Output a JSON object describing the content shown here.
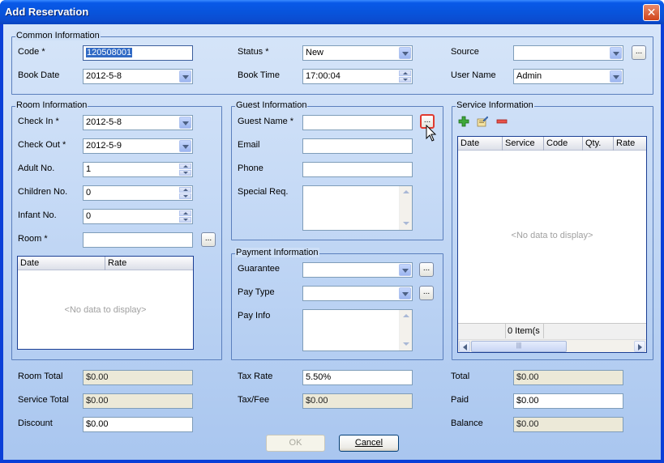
{
  "window": {
    "title": "Add Reservation",
    "close_glyph": "✕"
  },
  "common": {
    "title": "Common Information",
    "code_label": "Code *",
    "code_value": "120508001",
    "status_label": "Status *",
    "status_value": "New",
    "source_label": "Source",
    "source_value": "",
    "bookdate_label": "Book Date",
    "bookdate_value": "2012-5-8",
    "booktime_label": "Book Time",
    "booktime_value": "17:00:04",
    "username_label": "User Name",
    "username_value": "Admin"
  },
  "room": {
    "title": "Room Information",
    "checkin_label": "Check In *",
    "checkin_value": "2012-5-8",
    "checkout_label": "Check Out *",
    "checkout_value": "2012-5-9",
    "adult_label": "Adult No.",
    "adult_value": "1",
    "children_label": "Children No.",
    "children_value": "0",
    "infant_label": "Infant No.",
    "infant_value": "0",
    "room_label": "Room *",
    "room_value": "",
    "grid_cols": [
      "Date",
      "Rate"
    ],
    "grid_empty": "<No data to display>"
  },
  "guest": {
    "title": "Guest Information",
    "name_label": "Guest Name *",
    "email_label": "Email",
    "phone_label": "Phone",
    "special_label": "Special Req."
  },
  "payment": {
    "title": "Payment Information",
    "guarantee_label": "Guarantee",
    "paytype_label": "Pay Type",
    "payinfo_label": "Pay Info"
  },
  "service": {
    "title": "Service Information",
    "grid_cols": [
      "Date",
      "Service",
      "Code",
      "Qty.",
      "Rate"
    ],
    "grid_empty": "<No data to display>",
    "item_count": "0 Item(s"
  },
  "totals": {
    "room_total_label": "Room Total",
    "room_total_value": "$0.00",
    "service_total_label": "Service Total",
    "service_total_value": "$0.00",
    "discount_label": "Discount",
    "discount_value": "$0.00",
    "tax_rate_label": "Tax Rate",
    "tax_rate_value": "5.50%",
    "taxfee_label": "Tax/Fee",
    "taxfee_value": "$0.00",
    "total_label": "Total",
    "total_value": "$0.00",
    "paid_label": "Paid",
    "paid_value": "$0.00",
    "balance_label": "Balance",
    "balance_value": "$0.00"
  },
  "buttons": {
    "ok": "OK",
    "cancel": "Cancel",
    "ellipsis": "..."
  },
  "colors": {
    "title_bar": "#0854dc",
    "client_bg": "#c3d8f5",
    "close_red": "#d0441c",
    "hot_border": "#e03a30"
  }
}
